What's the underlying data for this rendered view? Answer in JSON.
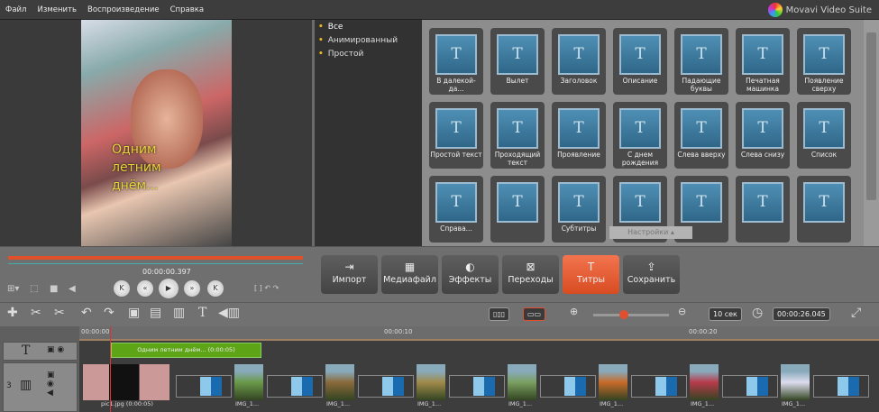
{
  "menu": [
    "Файл",
    "Изменить",
    "Воспроизведение",
    "Справка"
  ],
  "app_title": "Movavi Video Suite",
  "preview": {
    "caption_lines": [
      "Одним",
      "летним",
      "днём..."
    ],
    "time": "00:00:00.397"
  },
  "categories": [
    {
      "label": "Все",
      "selected": true
    },
    {
      "label": "Анимированный"
    },
    {
      "label": "Простой"
    }
  ],
  "titles": [
    "В далекой-да...",
    "Вылет",
    "Заголовок",
    "Описание",
    "Падающие буквы",
    "Печатная машинка",
    "Появление сверху",
    "Простой текст",
    "Проходящий текст",
    "Проявление",
    "С днем рождения",
    "Слева вверху",
    "Слева снизу",
    "Список",
    "Справа...",
    "",
    "Субтитры",
    "",
    "",
    "",
    ""
  ],
  "title_icon_glyph": "T",
  "settings_tab": "Настройки",
  "player_buttons": [
    {
      "name": "go-start",
      "glyph": "K"
    },
    {
      "name": "rewind",
      "glyph": "«"
    },
    {
      "name": "play",
      "glyph": "▶"
    },
    {
      "name": "forward",
      "glyph": "»"
    },
    {
      "name": "go-end",
      "glyph": "K"
    }
  ],
  "main_buttons": [
    {
      "label": "Импорт",
      "icon": "⇥"
    },
    {
      "label": "Медиафайл",
      "icon": "▦"
    },
    {
      "label": "Эффекты",
      "icon": "◐"
    },
    {
      "label": "Переходы",
      "icon": "⊠"
    },
    {
      "label": "Титры",
      "icon": "T",
      "active": true
    },
    {
      "label": "Сохранить",
      "icon": "⇪"
    }
  ],
  "timeline": {
    "scale_label": "10 сек",
    "duration": "00:00:26.045",
    "ruler": [
      "00:00:00",
      "00:00:10",
      "00:00:20"
    ],
    "title_clip": "Одним летним днём... (0:00:05)",
    "track_number": "3",
    "clips": [
      "pic1.jpg (0:00:05)",
      "IMG_1...",
      "IMG_1...",
      "IMG_1...",
      "IMG_1...",
      "IMG_1...",
      "IMG_1...",
      "IMG_1..."
    ]
  },
  "colors": {
    "accent": "#e0502a",
    "title_clip": "#5da516",
    "tile": "#2f6789"
  }
}
